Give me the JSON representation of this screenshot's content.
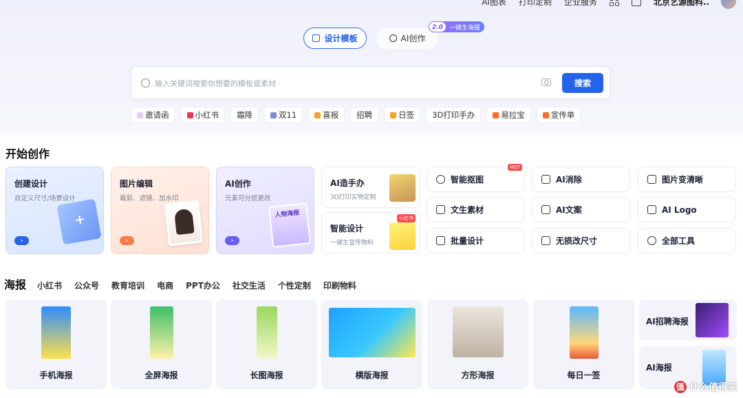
{
  "topnav": {
    "links": [
      "AI图表",
      "打印定制",
      "企业服务"
    ],
    "company": "北京艺源图科..."
  },
  "mode_tabs": {
    "design": "设计模板",
    "ai": "AI创作",
    "badge_version": "2.0",
    "badge_text": "一键生海报"
  },
  "search": {
    "placeholder": "输入关键词搜索你想要的模板或素材",
    "button": "搜索"
  },
  "tags": [
    {
      "label": "邀请函",
      "color": "#e8c9f0"
    },
    {
      "label": "小红书",
      "color": "#e8384d"
    },
    {
      "label": "霜降",
      "color": ""
    },
    {
      "label": "双11",
      "color": "#7a8cd9"
    },
    {
      "label": "喜报",
      "color": "#f0a330"
    },
    {
      "label": "招聘",
      "color": ""
    },
    {
      "label": "日签",
      "color": "#f7a12b"
    },
    {
      "label": "3D打印手办",
      "color": ""
    },
    {
      "label": "易拉宝",
      "color": "#ff6a2b"
    },
    {
      "label": "宣传单",
      "color": "#ff6a2b"
    }
  ],
  "start": {
    "title": "开始创作",
    "create": {
      "title": "创建设计",
      "sub": "自定义尺寸/场景设计"
    },
    "edit": {
      "title": "图片编辑",
      "sub": "裁剪、滤镜、加水印"
    },
    "ai": {
      "title": "AI创作",
      "sub": "元素可分层更改",
      "thumb_text": "人物海报"
    },
    "figure": {
      "title": "AI造手办",
      "sub": "3D打印实物定制"
    },
    "smart": {
      "title": "智能设计",
      "sub": "一键生宣传物料",
      "badge": "小红书"
    },
    "tools": [
      "智能抠图",
      "AI消除",
      "图片变清晰",
      "文生素材",
      "AI文案",
      "AI Logo",
      "批量设计",
      "无损改尺寸",
      "全部工具"
    ],
    "hot_badge": "HOT"
  },
  "categories": [
    "海报",
    "小红书",
    "公众号",
    "教育培训",
    "电商",
    "PPT办公",
    "社交生活",
    "个性定制",
    "印刷物料"
  ],
  "posters": [
    "手机海报",
    "全屏海报",
    "长图海报",
    "横版海报",
    "方形海报",
    "每日一签"
  ],
  "side_posters": [
    "AI招聘海报",
    "AI海报"
  ],
  "watermark": "什么值得买"
}
